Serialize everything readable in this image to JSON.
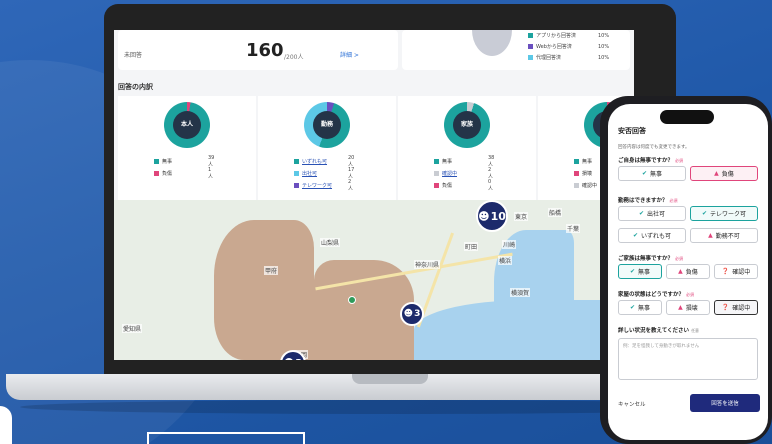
{
  "summary": {
    "label": "未回答",
    "count": "160",
    "denominator": "/200人",
    "link": "詳細 >"
  },
  "summary2": {
    "legend": [
      {
        "label": "アプリから回答済",
        "pct": "10%",
        "color": "#1ca39e"
      },
      {
        "label": "Webから回答済",
        "pct": "10%",
        "color": "#6a4fbf"
      },
      {
        "label": "代理回答済",
        "pct": "10%",
        "color": "#5cc8e6"
      }
    ]
  },
  "section_title": "回答の内訳",
  "cards": [
    {
      "center": "本人",
      "legend": [
        {
          "label": "無事",
          "count": "39人",
          "color": "#1ca39e"
        },
        {
          "label": "負傷",
          "count": "1人",
          "color": "#e0457b"
        }
      ]
    },
    {
      "center": "勤務",
      "legend": [
        {
          "label": "いずれも可",
          "count": "20人",
          "color": "#1ca39e"
        },
        {
          "label": "出社可",
          "count": "17人",
          "color": "#5cc8e6"
        },
        {
          "label": "テレワーク可",
          "count": "2人",
          "color": "#6a4fbf"
        }
      ]
    },
    {
      "center": "家族",
      "legend": [
        {
          "label": "無事",
          "count": "38人",
          "color": "#1ca39e"
        },
        {
          "label": "確認中",
          "count": "2人",
          "color": "#c9ccd2"
        },
        {
          "label": "負傷",
          "count": "0人",
          "color": "#e0457b"
        }
      ]
    },
    {
      "center": "",
      "legend": [
        {
          "label": "無事",
          "count": "",
          "color": "#1ca39e"
        },
        {
          "label": "損壊",
          "count": "",
          "color": "#e0457b"
        },
        {
          "label": "確認中",
          "count": "",
          "color": "#c9ccd2"
        }
      ]
    }
  ],
  "map": {
    "labels": [
      "東京",
      "千葉",
      "横浜",
      "川崎",
      "山梨県",
      "神奈川県",
      "横須賀",
      "静岡",
      "町田",
      "愛知県",
      "船橋",
      "甲府"
    ],
    "pins": [
      {
        "count": "10"
      },
      {
        "count": "3"
      },
      {
        "count": "2"
      }
    ]
  },
  "phone": {
    "title": "安否回答",
    "note": "回答内容は何度でも変更できます。",
    "required": "必須",
    "q1": "ご自身は無事ですか？",
    "q1_opts": [
      "無事",
      "負傷"
    ],
    "q2": "勤務はできますか？",
    "q2_opts": [
      "出社可",
      "テレワーク可",
      "いずれも可",
      "勤務不可"
    ],
    "q3": "ご家族は無事ですか？",
    "q3_opts": [
      "無事",
      "負傷",
      "確認中"
    ],
    "q4": "家屋の状態はどうですか？",
    "q4_opts": [
      "無事",
      "損壊",
      "確認中"
    ],
    "q5": "詳しい状況を教えてください",
    "q5_tag": "任意",
    "placeholder": "例：足を怪我して身動きが取れません",
    "cancel": "キャンセル",
    "submit": "回答を送信"
  }
}
